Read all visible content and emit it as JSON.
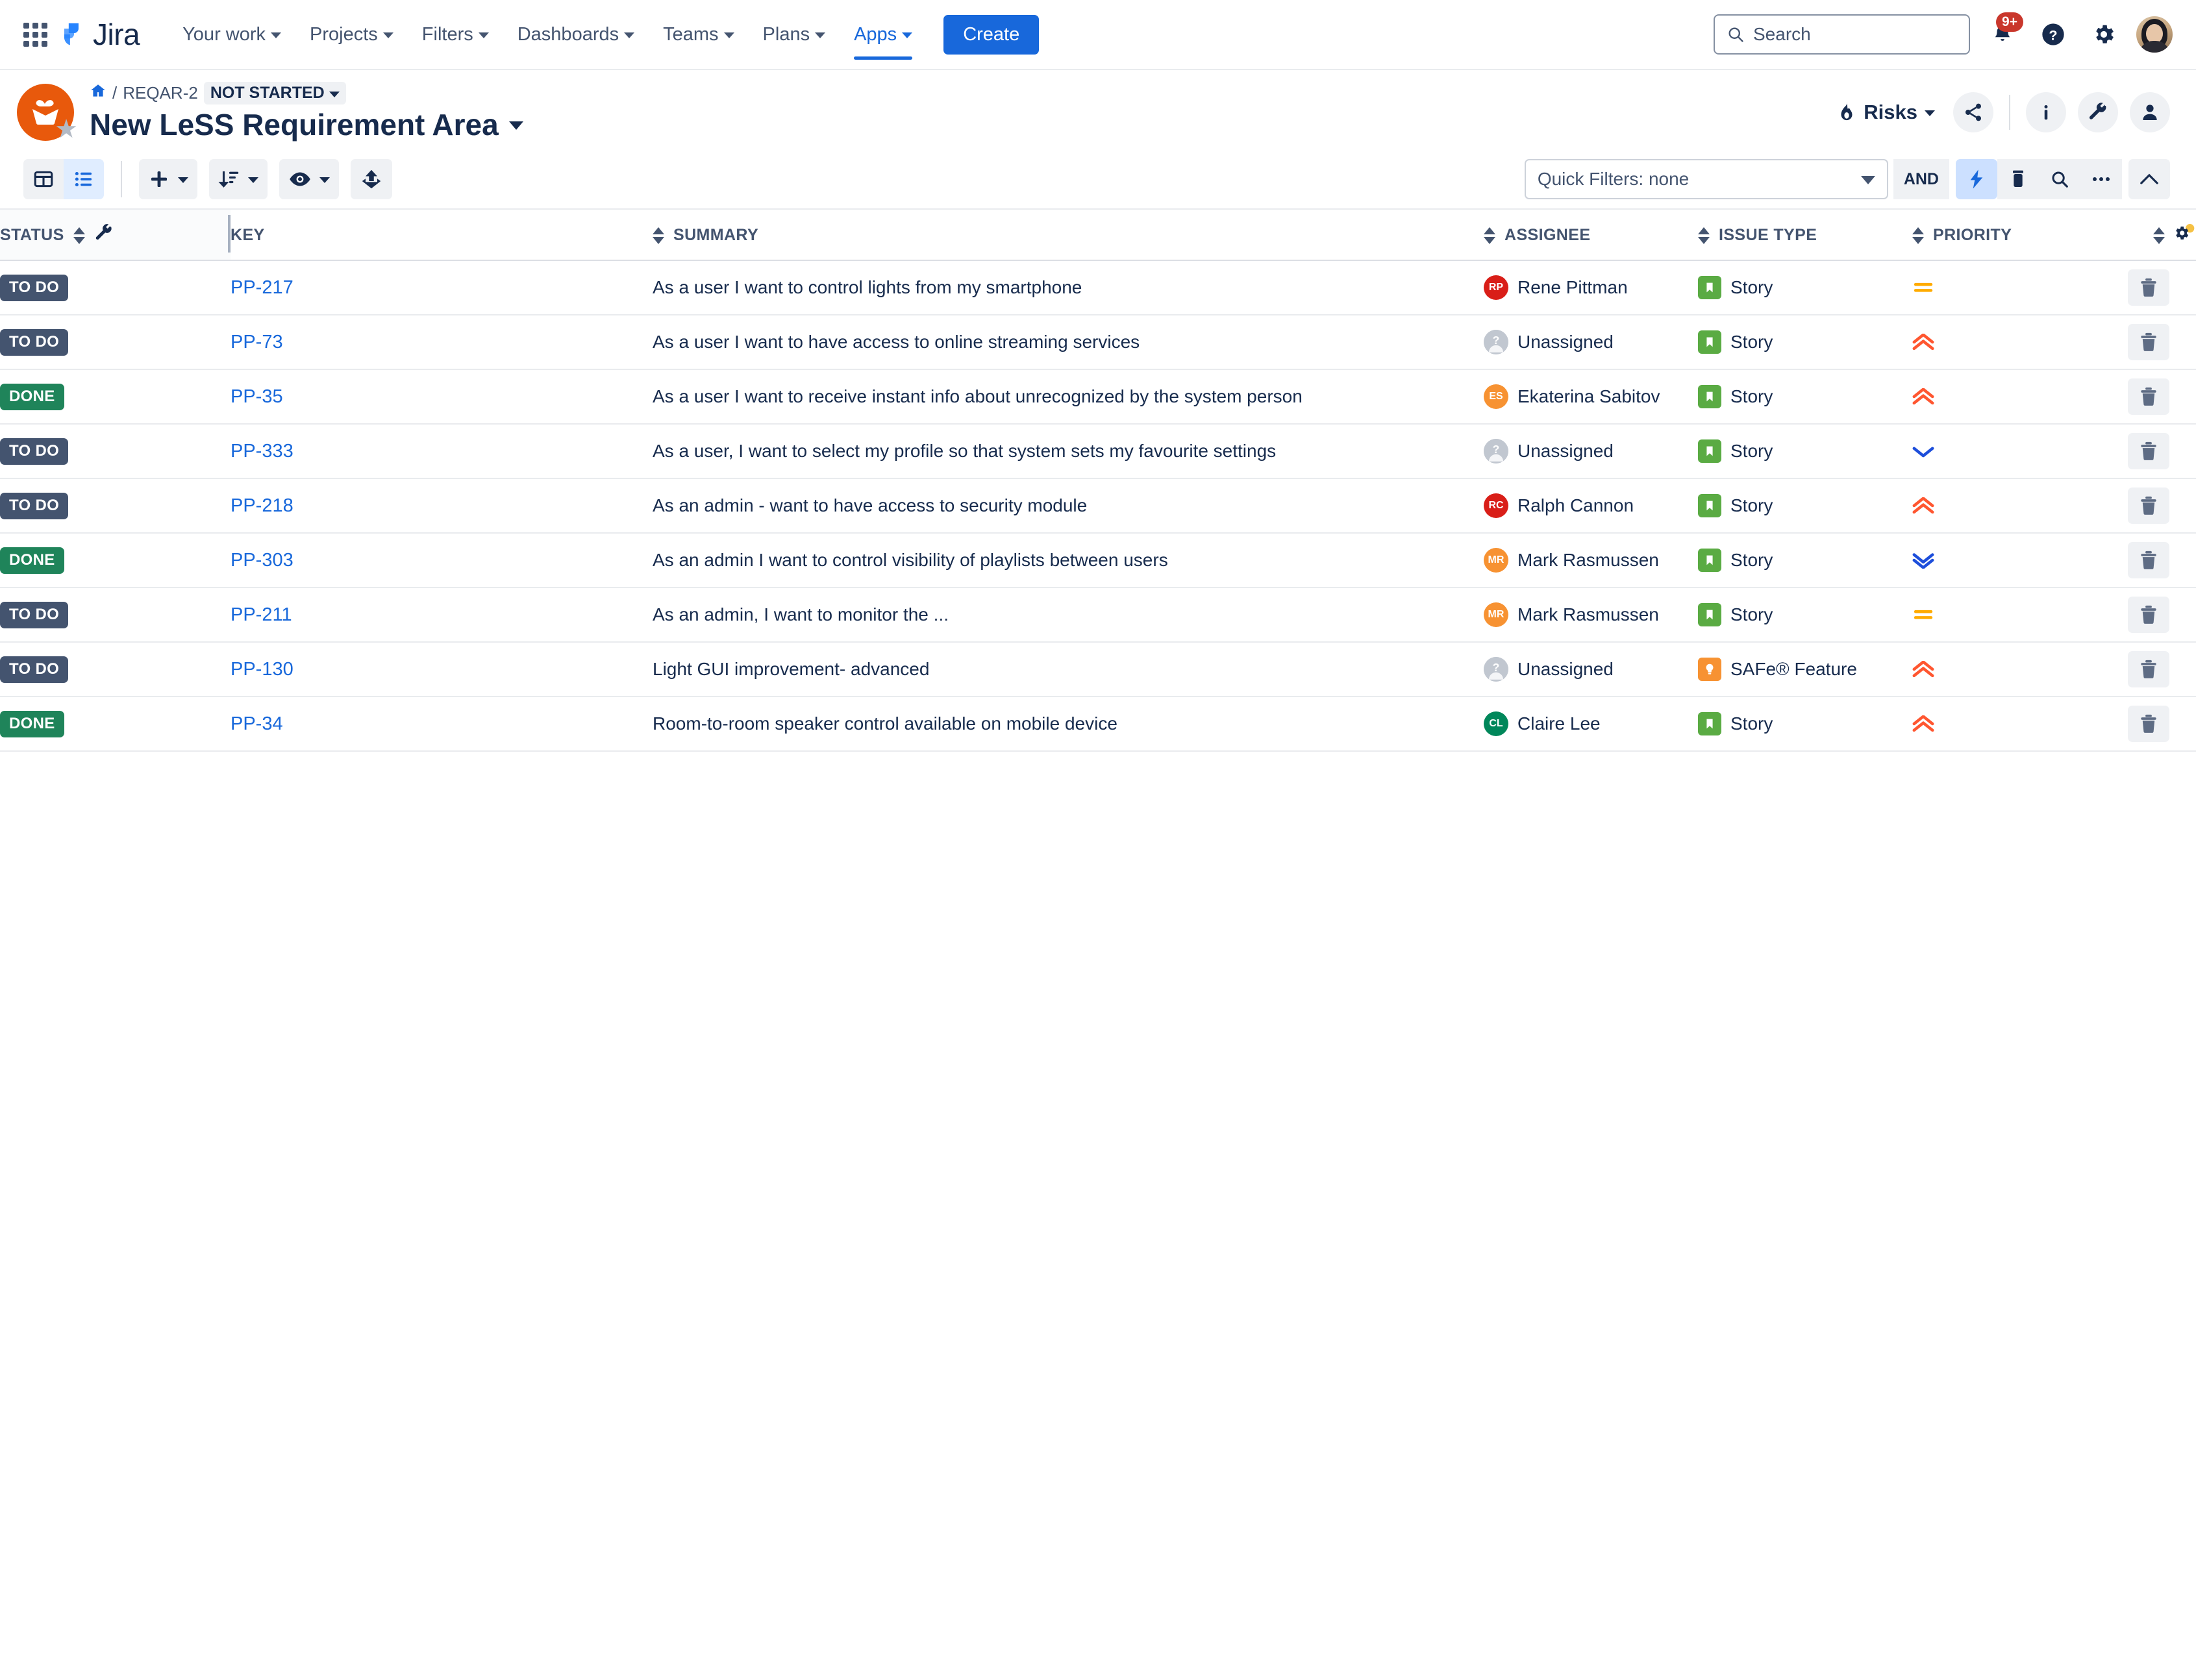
{
  "topnav": {
    "logo_text": "Jira",
    "links": [
      {
        "label": "Your work",
        "active": false
      },
      {
        "label": "Projects",
        "active": false
      },
      {
        "label": "Filters",
        "active": false
      },
      {
        "label": "Dashboards",
        "active": false
      },
      {
        "label": "Teams",
        "active": false
      },
      {
        "label": "Plans",
        "active": false
      },
      {
        "label": "Apps",
        "active": true
      }
    ],
    "create_label": "Create",
    "search_placeholder": "Search",
    "notification_badge": "9+"
  },
  "project": {
    "breadcrumb_key": "REQAR-2",
    "breadcrumb_separator": "/",
    "status_label": "NOT STARTED",
    "title": "New LeSS Requirement Area",
    "risks_label": "Risks"
  },
  "toolbar": {
    "quick_filters_label": "Quick Filters: none",
    "and_label": "AND"
  },
  "table": {
    "columns": [
      {
        "key": "status",
        "label": "STATUS"
      },
      {
        "key": "key",
        "label": "KEY"
      },
      {
        "key": "summary",
        "label": "SUMMARY"
      },
      {
        "key": "assignee",
        "label": "ASSIGNEE"
      },
      {
        "key": "type",
        "label": "ISSUE TYPE"
      },
      {
        "key": "priority",
        "label": "PRIORITY"
      },
      {
        "key": "actions",
        "label": ""
      }
    ],
    "rows": [
      {
        "status": "TO DO",
        "status_kind": "todo",
        "key": "PP-217",
        "summary": "As a user I want to control lights from my smartphone",
        "assignee": "Rene Pittman",
        "assignee_initials": "RP",
        "assignee_color": "#D91E18",
        "type": "Story",
        "type_kind": "story",
        "priority": "Medium",
        "priority_kind": "medium"
      },
      {
        "status": "TO DO",
        "status_kind": "todo",
        "key": "PP-73",
        "summary": "As a user I want to have access to online streaming services",
        "assignee": "Unassigned",
        "assignee_initials": "?",
        "assignee_color": "#C1C7D0",
        "type": "Story",
        "type_kind": "story",
        "priority": "High",
        "priority_kind": "high"
      },
      {
        "status": "DONE",
        "status_kind": "done",
        "key": "PP-35",
        "summary": "As a user I want to receive instant info about unrecognized by the system person",
        "assignee": "Ekaterina Sabitov",
        "assignee_initials": "ES",
        "assignee_color": "#F79232",
        "type": "Story",
        "type_kind": "story",
        "priority": "High",
        "priority_kind": "high"
      },
      {
        "status": "TO DO",
        "status_kind": "todo",
        "key": "PP-333",
        "summary": "As a user, I want to select my profile so that system sets my favourite settings",
        "assignee": "Unassigned",
        "assignee_initials": "?",
        "assignee_color": "#C1C7D0",
        "type": "Story",
        "type_kind": "story",
        "priority": "Low",
        "priority_kind": "low"
      },
      {
        "status": "TO DO",
        "status_kind": "todo",
        "key": "PP-218",
        "summary": "As an admin - want to have access to security module",
        "assignee": "Ralph Cannon",
        "assignee_initials": "RC",
        "assignee_color": "#D91E18",
        "type": "Story",
        "type_kind": "story",
        "priority": "High",
        "priority_kind": "high"
      },
      {
        "status": "DONE",
        "status_kind": "done",
        "key": "PP-303",
        "summary": "As an admin I want to control visibility of playlists between users",
        "assignee": "Mark Rasmussen",
        "assignee_initials": "MR",
        "assignee_color": "#F79232",
        "type": "Story",
        "type_kind": "story",
        "priority": "Lowest",
        "priority_kind": "lowest"
      },
      {
        "status": "TO DO",
        "status_kind": "todo",
        "key": "PP-211",
        "summary": "As an admin, I want to monitor the ...",
        "assignee": "Mark Rasmussen",
        "assignee_initials": "MR",
        "assignee_color": "#F79232",
        "type": "Story",
        "type_kind": "story",
        "priority": "Medium",
        "priority_kind": "medium"
      },
      {
        "status": "TO DO",
        "status_kind": "todo",
        "key": "PP-130",
        "summary": "Light GUI improvement- advanced",
        "assignee": "Unassigned",
        "assignee_initials": "?",
        "assignee_color": "#C1C7D0",
        "type": "SAFe® Feature",
        "type_kind": "feature",
        "priority": "High",
        "priority_kind": "high"
      },
      {
        "status": "DONE",
        "status_kind": "done",
        "key": "PP-34",
        "summary": "Room-to-room speaker control available on mobile device",
        "assignee": "Claire Lee",
        "assignee_initials": "CL",
        "assignee_color": "#00875A",
        "type": "Story",
        "type_kind": "story",
        "priority": "High",
        "priority_kind": "high"
      }
    ]
  },
  "colors": {
    "brand_blue": "#1868DB",
    "link_blue": "#1868DB",
    "todo_gray": "#44546F",
    "done_green": "#1F845A",
    "story_green": "#4BADE8",
    "high_red": "#FF5630",
    "medium_orange": "#FFAB00",
    "low_blue": "#0052CC"
  }
}
